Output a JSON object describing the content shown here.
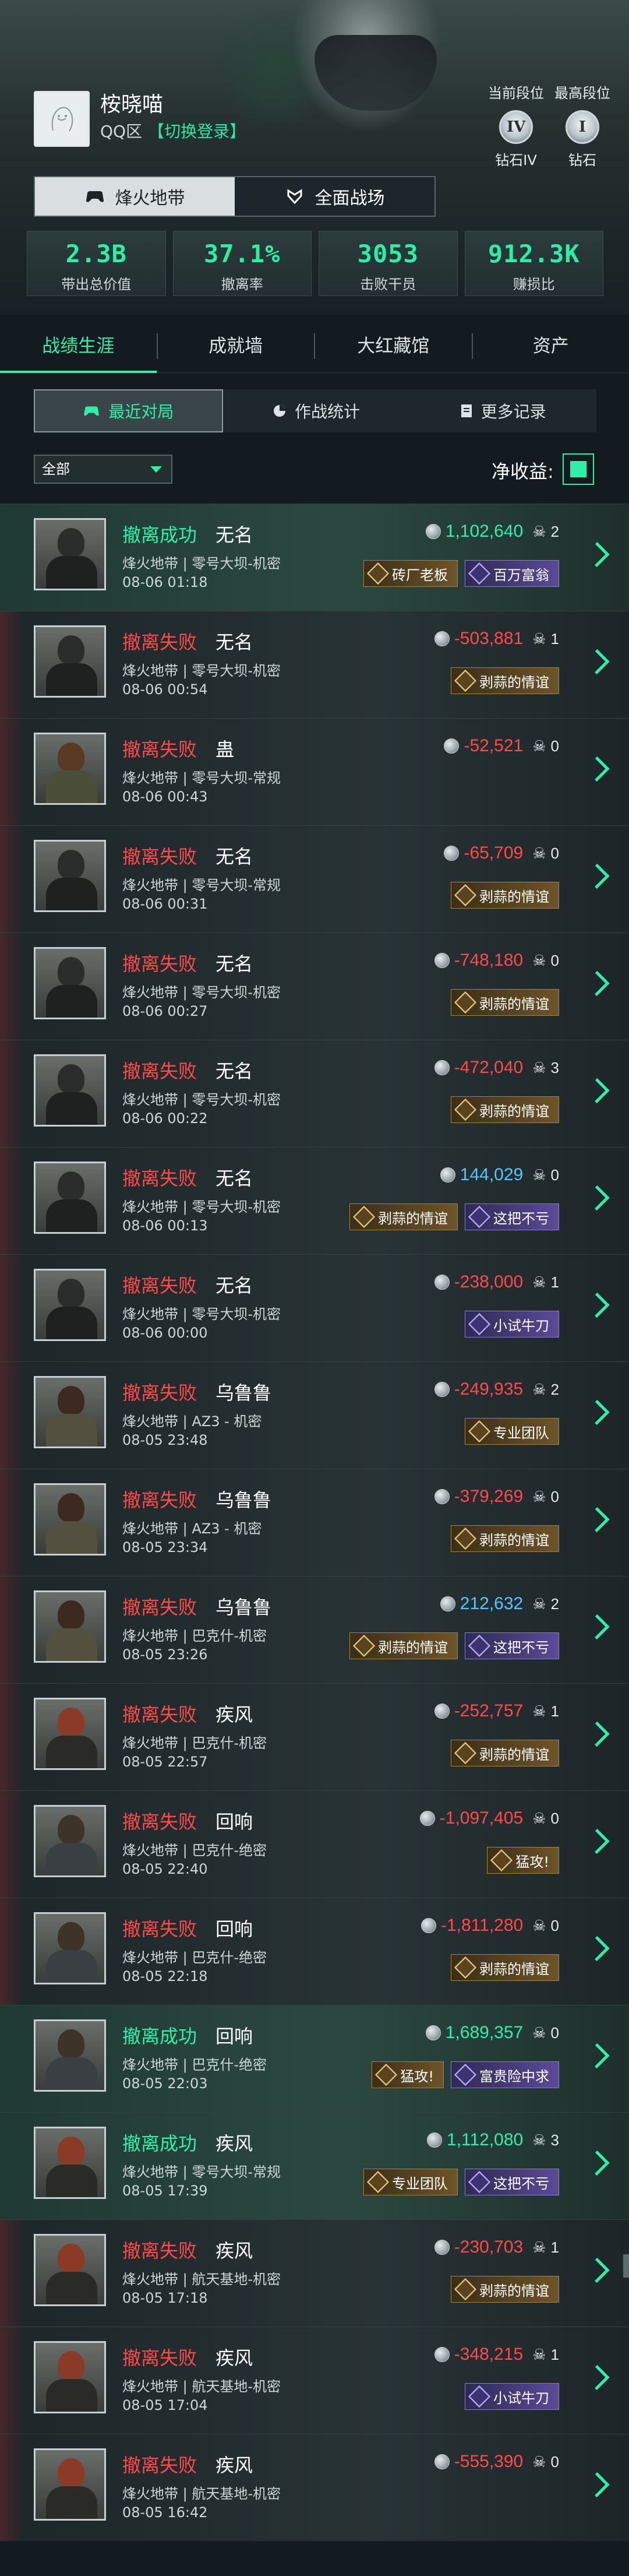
{
  "profile": {
    "name": "桉晓喵",
    "server": "QQ区",
    "switch_login": "【切换登录】",
    "current_rank_title": "当前段位",
    "highest_rank_title": "最高段位",
    "current_rank_numeral": "IV",
    "highest_rank_numeral": "I",
    "current_rank_name": "钻石IV",
    "highest_rank_name": "钻石"
  },
  "mode_toggle": {
    "options": [
      "烽火地带",
      "全面战场"
    ],
    "active_index": 0
  },
  "stats": [
    {
      "value": "2.3B",
      "label": "带出总价值"
    },
    {
      "value": "37.1%",
      "label": "撤离率"
    },
    {
      "value": "3053",
      "label": "击败干员"
    },
    {
      "value": "912.3K",
      "label": "赚损比"
    }
  ],
  "top_tabs": [
    "战绩生涯",
    "成就墙",
    "大红藏馆",
    "资产"
  ],
  "sub_tabs": [
    "最近对局",
    "作战统计",
    "更多记录"
  ],
  "filter": {
    "selected": "全部"
  },
  "net_profit_label": "净收益:",
  "matches": [
    {
      "result": "撤离成功",
      "op": "无名",
      "map": "烽火地带 | 零号大坝-机密",
      "time": "08-06 01:18",
      "value": "1,102,640",
      "kills": "2",
      "badges": [
        {
          "text": "砖厂老板",
          "type": "gold"
        },
        {
          "text": "百万富翁",
          "type": "purple"
        }
      ]
    },
    {
      "result": "撤离失败",
      "op": "无名",
      "map": "烽火地带 | 零号大坝-机密",
      "time": "08-06 00:54",
      "value": "-503,881",
      "kills": "1",
      "badges": [
        {
          "text": "剥蒜的情谊",
          "type": "gold"
        }
      ]
    },
    {
      "result": "撤离失败",
      "op": "蛊",
      "map": "烽火地带 | 零号大坝-常规",
      "time": "08-06 00:43",
      "value": "-52,521",
      "kills": "0",
      "badges": []
    },
    {
      "result": "撤离失败",
      "op": "无名",
      "map": "烽火地带 | 零号大坝-常规",
      "time": "08-06 00:31",
      "value": "-65,709",
      "kills": "0",
      "badges": [
        {
          "text": "剥蒜的情谊",
          "type": "gold"
        }
      ]
    },
    {
      "result": "撤离失败",
      "op": "无名",
      "map": "烽火地带 | 零号大坝-机密",
      "time": "08-06 00:27",
      "value": "-748,180",
      "kills": "0",
      "badges": [
        {
          "text": "剥蒜的情谊",
          "type": "gold"
        }
      ]
    },
    {
      "result": "撤离失败",
      "op": "无名",
      "map": "烽火地带 | 零号大坝-机密",
      "time": "08-06 00:22",
      "value": "-472,040",
      "kills": "3",
      "badges": [
        {
          "text": "剥蒜的情谊",
          "type": "gold"
        }
      ]
    },
    {
      "result": "撤离失败",
      "op": "无名",
      "map": "烽火地带 | 零号大坝-机密",
      "time": "08-06 00:13",
      "value": "144,029",
      "kills": "0",
      "badges": [
        {
          "text": "剥蒜的情谊",
          "type": "gold"
        },
        {
          "text": "这把不亏",
          "type": "purple"
        }
      ]
    },
    {
      "result": "撤离失败",
      "op": "无名",
      "map": "烽火地带 | 零号大坝-机密",
      "time": "08-06 00:00",
      "value": "-238,000",
      "kills": "1",
      "badges": [
        {
          "text": "小试牛刀",
          "type": "purple"
        }
      ]
    },
    {
      "result": "撤离失败",
      "op": "乌鲁鲁",
      "map": "烽火地带 | AZ3 - 机密",
      "time": "08-05 23:48",
      "value": "-249,935",
      "kills": "2",
      "badges": [
        {
          "text": "专业团队",
          "type": "gold"
        }
      ]
    },
    {
      "result": "撤离失败",
      "op": "乌鲁鲁",
      "map": "烽火地带 | AZ3 - 机密",
      "time": "08-05 23:34",
      "value": "-379,269",
      "kills": "0",
      "badges": [
        {
          "text": "剥蒜的情谊",
          "type": "gold"
        }
      ]
    },
    {
      "result": "撤离失败",
      "op": "乌鲁鲁",
      "map": "烽火地带 | 巴克什-机密",
      "time": "08-05 23:26",
      "value": "212,632",
      "kills": "2",
      "badges": [
        {
          "text": "剥蒜的情谊",
          "type": "gold"
        },
        {
          "text": "这把不亏",
          "type": "purple"
        }
      ]
    },
    {
      "result": "撤离失败",
      "op": "疾风",
      "map": "烽火地带 | 巴克什-机密",
      "time": "08-05 22:57",
      "value": "-252,757",
      "kills": "1",
      "badges": [
        {
          "text": "剥蒜的情谊",
          "type": "gold"
        }
      ]
    },
    {
      "result": "撤离失败",
      "op": "回响",
      "map": "烽火地带 | 巴克什-绝密",
      "time": "08-05 22:40",
      "value": "-1,097,405",
      "kills": "0",
      "badges": [
        {
          "text": "猛攻!",
          "type": "gold"
        }
      ]
    },
    {
      "result": "撤离失败",
      "op": "回响",
      "map": "烽火地带 | 巴克什-绝密",
      "time": "08-05 22:18",
      "value": "-1,811,280",
      "kills": "0",
      "badges": [
        {
          "text": "剥蒜的情谊",
          "type": "gold"
        }
      ]
    },
    {
      "result": "撤离成功",
      "op": "回响",
      "map": "烽火地带 | 巴克什-绝密",
      "time": "08-05 22:03",
      "value": "1,689,357",
      "kills": "0",
      "badges": [
        {
          "text": "猛攻!",
          "type": "gold"
        },
        {
          "text": "富贵险中求",
          "type": "purple"
        }
      ]
    },
    {
      "result": "撤离成功",
      "op": "疾风",
      "map": "烽火地带 | 零号大坝-常规",
      "time": "08-05 17:39",
      "value": "1,112,080",
      "kills": "3",
      "badges": [
        {
          "text": "专业团队",
          "type": "gold"
        },
        {
          "text": "这把不亏",
          "type": "purple"
        }
      ]
    },
    {
      "result": "撤离失败",
      "op": "疾风",
      "map": "烽火地带 | 航天基地-机密",
      "time": "08-05 17:18",
      "value": "-230,703",
      "kills": "1",
      "badges": [
        {
          "text": "剥蒜的情谊",
          "type": "gold"
        }
      ]
    },
    {
      "result": "撤离失败",
      "op": "疾风",
      "map": "烽火地带 | 航天基地-机密",
      "time": "08-05 17:04",
      "value": "-348,215",
      "kills": "1",
      "badges": [
        {
          "text": "小试牛刀",
          "type": "purple"
        }
      ]
    },
    {
      "result": "撤离失败",
      "op": "疾风",
      "map": "烽火地带 | 航天基地-机密",
      "time": "08-05 16:42",
      "value": "-555,390",
      "kills": "0",
      "badges": []
    }
  ],
  "colors": {
    "accent": "#2ef0a9",
    "fail": "#ff4a4a",
    "positive_value": "#2ef0a9",
    "positive_blue": "#4fc7ff"
  },
  "icons": {
    "mode_fire": "gamepad-icon",
    "mode_battle": "shield-icon",
    "recent": "gamepad-icon",
    "stats": "pie-chart-icon",
    "more": "document-icon",
    "coin": "coin-icon",
    "kills": "skull-icon",
    "go": "chevron-right-icon"
  }
}
